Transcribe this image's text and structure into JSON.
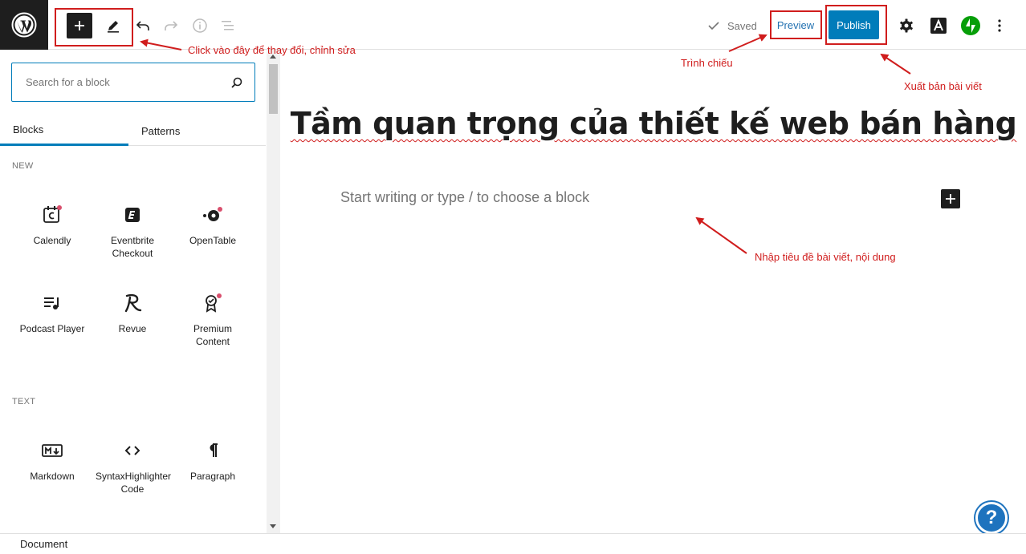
{
  "toolbar": {
    "saved_label": "Saved",
    "preview_label": "Preview",
    "publish_label": "Publish"
  },
  "sidebar": {
    "search_placeholder": "Search for a block",
    "tabs": [
      {
        "label": "Blocks",
        "active": true
      },
      {
        "label": "Patterns",
        "active": false
      }
    ],
    "sections": [
      {
        "title": "NEW",
        "blocks": [
          {
            "label": "Calendly",
            "icon": "calendly-icon"
          },
          {
            "label": "Eventbrite Checkout",
            "icon": "eventbrite-icon"
          },
          {
            "label": "OpenTable",
            "icon": "opentable-icon"
          },
          {
            "label": "Podcast Player",
            "icon": "podcast-icon"
          },
          {
            "label": "Revue",
            "icon": "revue-icon"
          },
          {
            "label": "Premium Content",
            "icon": "premium-icon"
          }
        ]
      },
      {
        "title": "TEXT",
        "blocks": [
          {
            "label": "Markdown",
            "icon": "markdown-icon"
          },
          {
            "label": "SyntaxHighlighter Code",
            "icon": "code-icon"
          },
          {
            "label": "Paragraph",
            "icon": "paragraph-icon"
          }
        ]
      }
    ]
  },
  "editor": {
    "title": "Tầm quan trọng của thiết kế web bán hàng",
    "placeholder": "Start writing or type / to choose a block"
  },
  "footer": {
    "breadcrumb": "Document"
  },
  "annotations": {
    "edit_note": "Click vào đây để thay đổi, chỉnh sửa",
    "preview_note": "Trình chiếu",
    "publish_note": "Xuất bản bài viết",
    "content_note": "Nhập tiêu đề bài viết, nội dung"
  },
  "colors": {
    "accent": "#007cba",
    "annotation": "#d01d1d",
    "dark": "#1e1e1e",
    "jetpack": "#069e08"
  }
}
